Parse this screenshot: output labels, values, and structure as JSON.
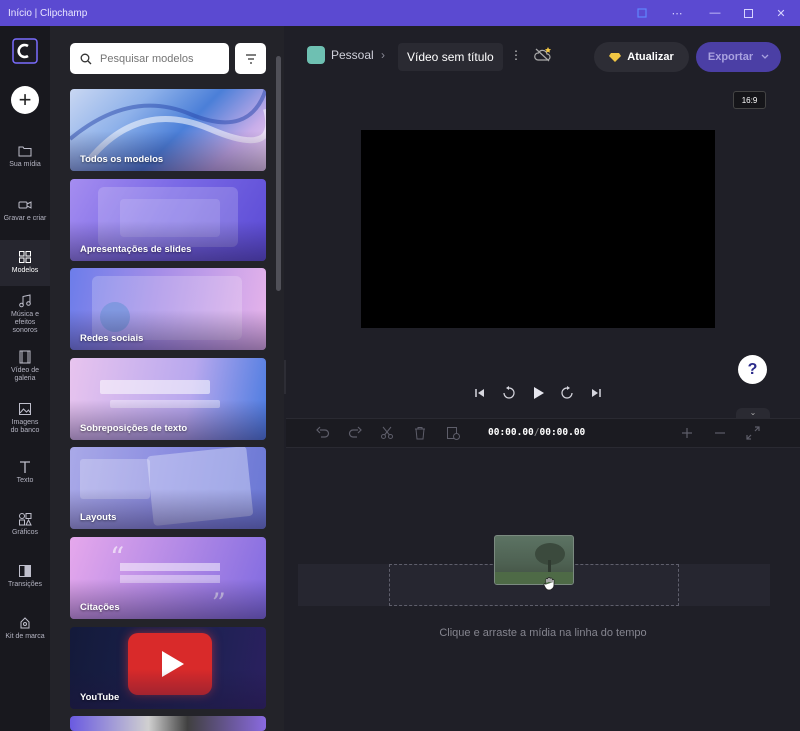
{
  "window": {
    "title": "Início | Clipchamp"
  },
  "rail": {
    "items": [
      {
        "label": "Sua mídia"
      },
      {
        "label": "Gravar e criar"
      },
      {
        "label": "Modelos"
      },
      {
        "label": "Música e efeitos sonoros"
      },
      {
        "label": "Vídeo de galeria"
      },
      {
        "label": "Imagens do banco"
      },
      {
        "label": "Texto"
      },
      {
        "label": "Gráficos"
      },
      {
        "label": "Transições"
      },
      {
        "label": "Kit de marca"
      }
    ]
  },
  "panel": {
    "search_placeholder": "Pesquisar modelos",
    "cards": [
      {
        "label": "Todos os modelos"
      },
      {
        "label": "Apresentações de slides"
      },
      {
        "label": "Redes sociais"
      },
      {
        "label": "Sobreposições de texto"
      },
      {
        "label": "Layouts"
      },
      {
        "label": "Citações"
      },
      {
        "label": "YouTube"
      }
    ]
  },
  "header": {
    "workspace": "Pessoal",
    "project_title": "Vídeo sem título",
    "upgrade_label": "Atualizar",
    "export_label": "Exportar"
  },
  "preview": {
    "aspect_ratio": "16:9",
    "help_label": "?"
  },
  "timeline": {
    "current_time": "00:00.00",
    "separator": "/",
    "total_time": "00:00.00",
    "hint": "Clique e arraste a mídia na linha do tempo"
  },
  "colors": {
    "accent": "#5b4ad1",
    "export_bg": "#4b3fa5"
  }
}
